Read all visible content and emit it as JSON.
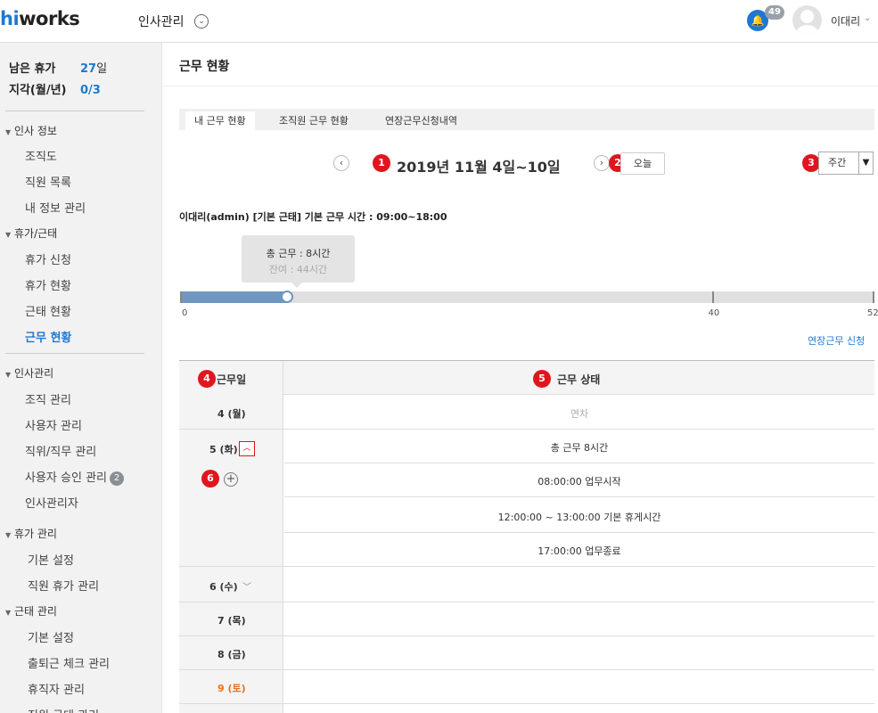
{
  "header": {
    "logo_hi": "hi",
    "logo_rest": "works",
    "menu_title": "인사관리",
    "notification_count": "49",
    "user_name": "이대리"
  },
  "sidebar": {
    "remaining_leave_label": "남은 휴가",
    "remaining_leave_value": "27",
    "remaining_leave_unit": "일",
    "late_label": "지각(월/년)",
    "late_value": "0/3",
    "groups": [
      {
        "label": "인사 정보",
        "items": [
          "조직도",
          "직원 목록",
          "내 정보 관리"
        ]
      },
      {
        "label": "휴가/근태",
        "items": [
          "휴가 신청",
          "휴가 현황",
          "근태 현황",
          "근무 현황"
        ]
      },
      {
        "label": "인사관리",
        "items": [
          "조직 관리",
          "사용자 관리",
          "직위/직무 관리",
          "사용자 승인 관리",
          "인사관리자"
        ]
      },
      {
        "label": "휴가 관리",
        "items": [
          "기본 설정",
          "직원 휴가 관리"
        ]
      },
      {
        "label": "근태 관리",
        "items": [
          "기본 설정",
          "출퇴근 체크 관리",
          "휴직자 관리",
          "직원 근태 관리"
        ]
      }
    ],
    "approval_badge": "2"
  },
  "main": {
    "page_title": "근무 현황",
    "tabs": [
      "내 근무 현황",
      "조직원 근무 현황",
      "연장근무신청내역"
    ],
    "date_range": "2019년 11월 4일~10일",
    "today_label": "오늘",
    "view_mode": "주간",
    "info_line": "이대리(admin) [기본 근태] 기본 근무 시간 : 09:00~18:00",
    "tooltip_total": "총 근무 : 8시간",
    "tooltip_remaining": "잔여 : 44시간",
    "progress": {
      "worked_hours": 8,
      "max_hours": 52,
      "mark_hours": 40
    },
    "axis_labels": {
      "start": "0",
      "mid": "40",
      "end": "52"
    },
    "overtime_link": "연장근무 신청",
    "table": {
      "col_day": "근무일",
      "col_status": "근무 상태",
      "rows": [
        {
          "day": "4 (월)",
          "status": "연차"
        },
        {
          "day": "5 (화)",
          "details": [
            "총 근무 8시간",
            "08:00:00 업무시작",
            "12:00:00 ~ 13:00:00 기본 휴게시간",
            "17:00:00 업무종료"
          ]
        },
        {
          "day": "6 (수)",
          "status": ""
        },
        {
          "day": "7 (목)",
          "status": ""
        },
        {
          "day": "8 (금)",
          "status": ""
        },
        {
          "day": "9 (토)",
          "status": ""
        }
      ]
    },
    "markers": [
      "1",
      "2",
      "3",
      "4",
      "5",
      "6"
    ]
  },
  "colors": {
    "accent": "#1e78d2",
    "marker": "#e0161f",
    "bar": "#6f97bf",
    "saturday": "#e8711f"
  }
}
